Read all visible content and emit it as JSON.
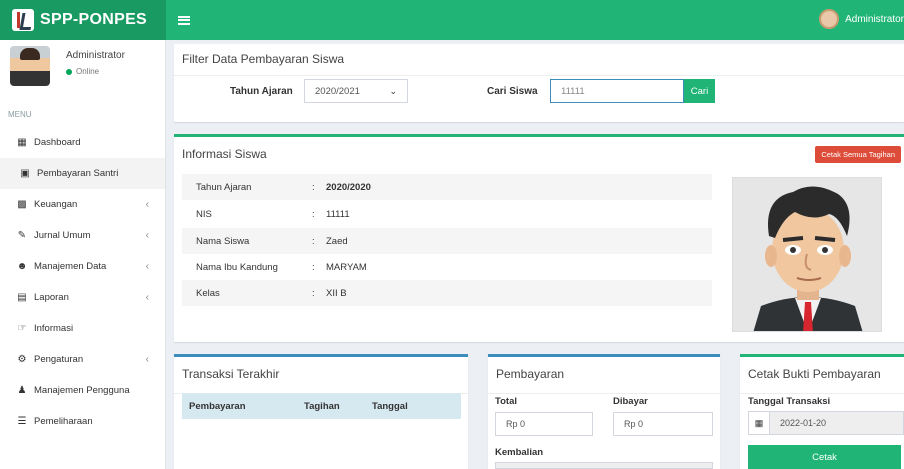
{
  "app": {
    "logo_text": "SPP-PONPES",
    "top_user": "Administrator"
  },
  "sidebar": {
    "user_name": "Administrator",
    "user_status": "Online",
    "menu_header": "MENU",
    "items": [
      {
        "label": "Dashboard",
        "icon": "grid-icon",
        "chevron": false
      },
      {
        "label": "Pembayaran Santri",
        "icon": "credit-card-icon",
        "chevron": false,
        "active": true
      },
      {
        "label": "Keuangan",
        "icon": "money-icon",
        "chevron": true
      },
      {
        "label": "Jurnal Umum",
        "icon": "edit-icon",
        "chevron": true
      },
      {
        "label": "Manajemen Data",
        "icon": "users-icon",
        "chevron": true
      },
      {
        "label": "Laporan",
        "icon": "file-icon",
        "chevron": true
      },
      {
        "label": "Informasi",
        "icon": "hand-point-icon",
        "chevron": false
      },
      {
        "label": "Pengaturan",
        "icon": "gear-icon",
        "chevron": true
      },
      {
        "label": "Manajemen Pengguna",
        "icon": "user-icon",
        "chevron": false
      },
      {
        "label": "Pemeliharaan",
        "icon": "database-icon",
        "chevron": false
      }
    ]
  },
  "filter": {
    "title": "Filter Data Pembayaran Siswa",
    "tahun_label": "Tahun Ajaran",
    "tahun_value": "2020/2021",
    "cari_label": "Cari Siswa",
    "cari_value": "11111",
    "cari_button": "Cari"
  },
  "info": {
    "title": "Informasi Siswa",
    "print_all_button": "Cetak Semua Tagihan",
    "rows": [
      {
        "key": "Tahun Ajaran",
        "value": "2020/2020"
      },
      {
        "key": "NIS",
        "value": "11111"
      },
      {
        "key": "Nama Siswa",
        "value": "Zaed"
      },
      {
        "key": "Nama Ibu Kandung",
        "value": "MARYAM"
      },
      {
        "key": "Kelas",
        "value": "XII B"
      }
    ],
    "colon": ":"
  },
  "transaksi": {
    "title": "Transaksi Terakhir",
    "columns": [
      "Pembayaran",
      "Tagihan",
      "Tanggal"
    ]
  },
  "pembayaran": {
    "title": "Pembayaran",
    "total_label": "Total",
    "total_value": "Rp 0",
    "dibayar_label": "Dibayar",
    "dibayar_value": "Rp 0",
    "kembalian_label": "Kembalian"
  },
  "bukti": {
    "title": "Cetak Bukti Pembayaran",
    "tanggal_label": "Tanggal Transaksi",
    "tanggal_value": "2022-01-20",
    "print_button": "Cetak"
  }
}
